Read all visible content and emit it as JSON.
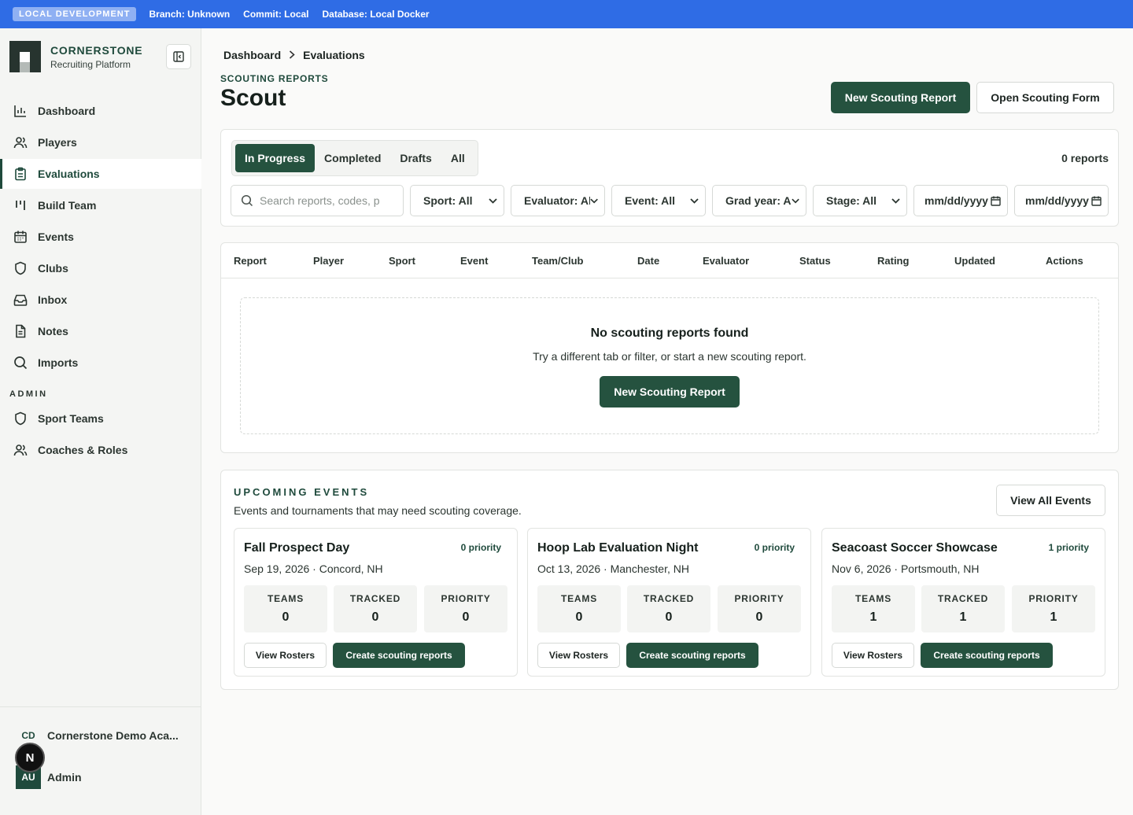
{
  "devbar": {
    "env": "LOCAL DEVELOPMENT",
    "branch": "Branch: Unknown",
    "commit": "Commit: Local",
    "database": "Database: Local Docker"
  },
  "brand": {
    "name": "CORNERSTONE",
    "subtitle": "Recruiting Platform"
  },
  "nav": [
    {
      "label": "Dashboard",
      "icon": "bar-chart-icon"
    },
    {
      "label": "Players",
      "icon": "users-icon"
    },
    {
      "label": "Evaluations",
      "icon": "clipboard-icon",
      "active": true
    },
    {
      "label": "Build Team",
      "icon": "columns-icon"
    },
    {
      "label": "Events",
      "icon": "calendar-icon"
    },
    {
      "label": "Clubs",
      "icon": "shield-icon"
    },
    {
      "label": "Inbox",
      "icon": "inbox-icon"
    },
    {
      "label": "Notes",
      "icon": "file-text-icon"
    },
    {
      "label": "Imports",
      "icon": "search-icon"
    }
  ],
  "admin": {
    "label": "ADMIN",
    "items": [
      {
        "label": "Sport Teams",
        "icon": "shield-icon"
      },
      {
        "label": "Coaches & Roles",
        "icon": "users-icon"
      }
    ]
  },
  "footer": {
    "org_initials": "CD",
    "org_name": "Cornerstone Demo Aca...",
    "dev_badge": "N",
    "user_initials": "AU",
    "user_name": "Admin"
  },
  "breadcrumb": {
    "home": "Dashboard",
    "current": "Evaluations"
  },
  "header": {
    "eyebrow": "SCOUTING REPORTS",
    "title": "Scout",
    "new_button": "New Scouting Report",
    "open_button": "Open Scouting Form"
  },
  "tabs": [
    "In Progress",
    "Completed",
    "Drafts",
    "All"
  ],
  "report_count": "0 reports",
  "filters": {
    "search_placeholder": "Search reports, codes, p",
    "selects": [
      "Sport: All",
      "Evaluator: All",
      "Event: All",
      "Grad year: All",
      "Stage: All"
    ],
    "date_placeholder": "mm/dd/yyyy"
  },
  "table": {
    "columns": [
      "Report",
      "Player",
      "Sport",
      "Event",
      "Team/Club",
      "Date",
      "Evaluator",
      "Status",
      "Rating",
      "Updated",
      "Actions"
    ],
    "empty_title": "No scouting reports found",
    "empty_subtitle": "Try a different tab or filter, or start a new scouting report.",
    "empty_button": "New Scouting Report"
  },
  "upcoming": {
    "title": "UPCOMING EVENTS",
    "subtitle": "Events and tournaments that may need scouting coverage.",
    "view_all": "View All Events",
    "stat_labels": [
      "TEAMS",
      "TRACKED",
      "PRIORITY"
    ],
    "roster_button": "View Rosters",
    "create_button": "Create scouting reports",
    "events": [
      {
        "name": "Fall Prospect Day",
        "priority": "0 priority",
        "date": "Sep 19, 2026 · Concord, NH",
        "teams": "0",
        "tracked": "0",
        "priority_count": "0"
      },
      {
        "name": "Hoop Lab Evaluation Night",
        "priority": "0 priority",
        "date": "Oct 13, 2026 · Manchester, NH",
        "teams": "0",
        "tracked": "0",
        "priority_count": "0"
      },
      {
        "name": "Seacoast Soccer Showcase",
        "priority": "1 priority",
        "date": "Nov 6, 2026 · Portsmouth, NH",
        "teams": "1",
        "tracked": "1",
        "priority_count": "1"
      }
    ]
  },
  "colors": {
    "accent": "#25523f",
    "devbar": "#2f6ce5"
  }
}
